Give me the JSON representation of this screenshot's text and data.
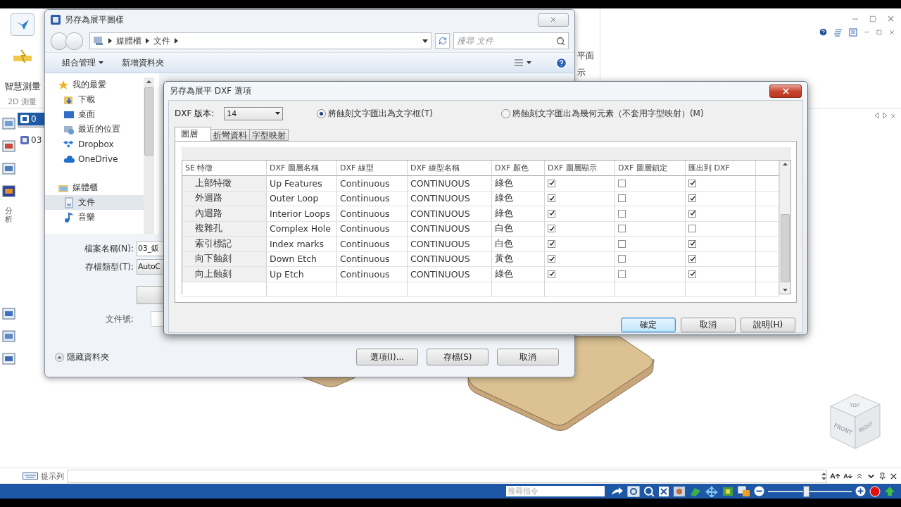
{
  "app": {
    "ribbon": {
      "tool_label": "智慧測量",
      "group_label": "2D 測量",
      "cut_labels": [
        "平面",
        "示"
      ]
    },
    "tree_items": [
      {
        "label": "0",
        "selected": true
      },
      {
        "label": "03",
        "selected": false
      }
    ],
    "side_label": "分析",
    "view_cube": {
      "faces": [
        "TOP",
        "FRONT",
        "RIGHT"
      ]
    },
    "prompt_bar": {
      "label": "提示列"
    },
    "status_bar": {
      "search": {
        "placeholder": "搜尋指令"
      },
      "zoom": {
        "level": 0.45
      }
    }
  },
  "save_dialog": {
    "title": "另存為展平圖樣",
    "breadcrumb": [
      "媒體櫃",
      "文件"
    ],
    "search": {
      "placeholder": "搜尋 文件"
    },
    "toolbar": [
      "組合管理",
      "新增資料夾"
    ],
    "nav": [
      {
        "label": "我的最愛",
        "kind": "group",
        "selected": false
      },
      {
        "label": "下載",
        "kind": "item",
        "selected": false
      },
      {
        "label": "桌面",
        "kind": "item",
        "selected": false
      },
      {
        "label": "最近的位置",
        "kind": "item",
        "selected": false
      },
      {
        "label": "Dropbox",
        "kind": "item",
        "selected": false
      },
      {
        "label": "OneDrive",
        "kind": "item",
        "selected": false
      },
      {
        "label": "媒體櫃",
        "kind": "group",
        "selected": false
      },
      {
        "label": "文件",
        "kind": "item",
        "selected": true
      },
      {
        "label": "音樂",
        "kind": "item",
        "selected": false
      }
    ],
    "fields": [
      {
        "label": "檔案名稱(N):",
        "value": "03_鈑",
        "kind": "text"
      },
      {
        "label": "存檔類型(T):",
        "value": "AutoC",
        "kind": "select"
      }
    ],
    "doc_number_label": "文件號:",
    "hide_folders": "隱藏資料夾",
    "buttons": [
      "選項(I)...",
      "存檔(S)",
      "取消"
    ]
  },
  "dxf_dialog": {
    "title": "另存為展平 DXF 選項",
    "version_label": "DXF 版本:",
    "version": "14",
    "radios": [
      {
        "label": "將蝕刻文字匯出為文字框(T)",
        "selected": true
      },
      {
        "label": "將蝕刻文字匯出為幾何元素（不套用字型映射）(M)",
        "selected": false
      }
    ],
    "tabs": [
      {
        "label": "圖層",
        "selected": true
      },
      {
        "label": "折彎資料",
        "selected": false
      },
      {
        "label": "字型映射",
        "selected": false
      }
    ],
    "table": {
      "columns": [
        "SE 特徵",
        "DXF 圖層名稱",
        "DXF 線型",
        "DXF 線型名稱",
        "DXF 顏色",
        "DXF 圖層顯示",
        "DXF 圖層鎖定",
        "匯出到 DXF"
      ],
      "rows": [
        {
          "feature": "上部特徵",
          "layer": "Up Features",
          "linetype": "Continuous",
          "linetype_name": "CONTINUOUS",
          "dxf_color": "綠色",
          "show": true,
          "lock": false,
          "export": true
        },
        {
          "feature": "外迴路",
          "layer": "Outer Loop",
          "linetype": "Continuous",
          "linetype_name": "CONTINUOUS",
          "dxf_color": "綠色",
          "show": true,
          "lock": false,
          "export": true
        },
        {
          "feature": "內迴路",
          "layer": "Interior Loops",
          "linetype": "Continuous",
          "linetype_name": "CONTINUOUS",
          "dxf_color": "綠色",
          "show": true,
          "lock": false,
          "export": true
        },
        {
          "feature": "複雜孔",
          "layer": "Complex Hole",
          "linetype": "Continuous",
          "linetype_name": "CONTINUOUS",
          "dxf_color": "白色",
          "show": true,
          "lock": false,
          "export": false
        },
        {
          "feature": "索引標記",
          "layer": "Index marks",
          "linetype": "Continuous",
          "linetype_name": "CONTINUOUS",
          "dxf_color": "白色",
          "show": true,
          "lock": false,
          "export": true
        },
        {
          "feature": "向下蝕刻",
          "layer": "Down Etch",
          "linetype": "Continuous",
          "linetype_name": "CONTINUOUS",
          "dxf_color": "黃色",
          "show": true,
          "lock": false,
          "export": true
        },
        {
          "feature": "向上蝕刻",
          "layer": "Up Etch",
          "linetype": "Continuous",
          "linetype_name": "CONTINUOUS",
          "dxf_color": "綠色",
          "show": true,
          "lock": false,
          "export": true
        }
      ]
    },
    "buttons": [
      {
        "label": "確定",
        "default": true
      },
      {
        "label": "取消",
        "default": false
      },
      {
        "label": "說明(H)",
        "default": false
      }
    ]
  }
}
